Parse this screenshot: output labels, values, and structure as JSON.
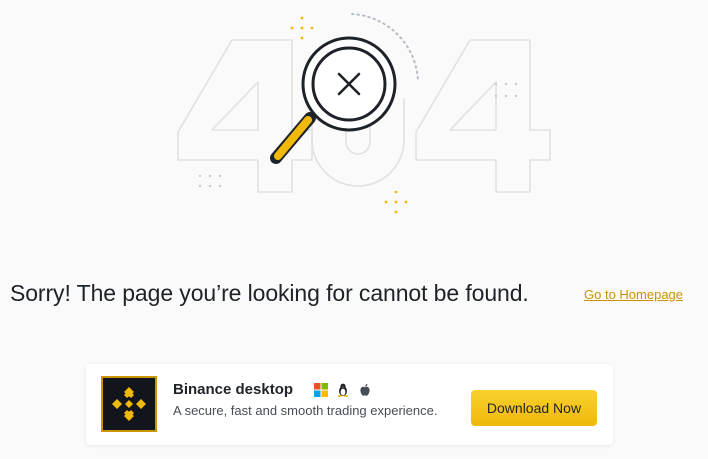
{
  "error_illustration": {
    "code_left": "4",
    "code_right": "4",
    "icon": "magnifier-x-icon"
  },
  "message": {
    "text": "Sorry! The page you’re looking for cannot be found.",
    "home_link": "Go to Homepage"
  },
  "download_card": {
    "app_logo_icon": "binance-logo-icon",
    "title": "Binance desktop",
    "subtitle": "A secure, fast and smooth trading experience.",
    "os_icons": [
      "windows-icon",
      "linux-icon",
      "apple-icon"
    ],
    "button_label": "Download Now"
  },
  "colors": {
    "brand_yellow": "#f0b90b",
    "link_gold": "#c99400",
    "text_dark": "#1e2329",
    "background": "#fafafa"
  }
}
